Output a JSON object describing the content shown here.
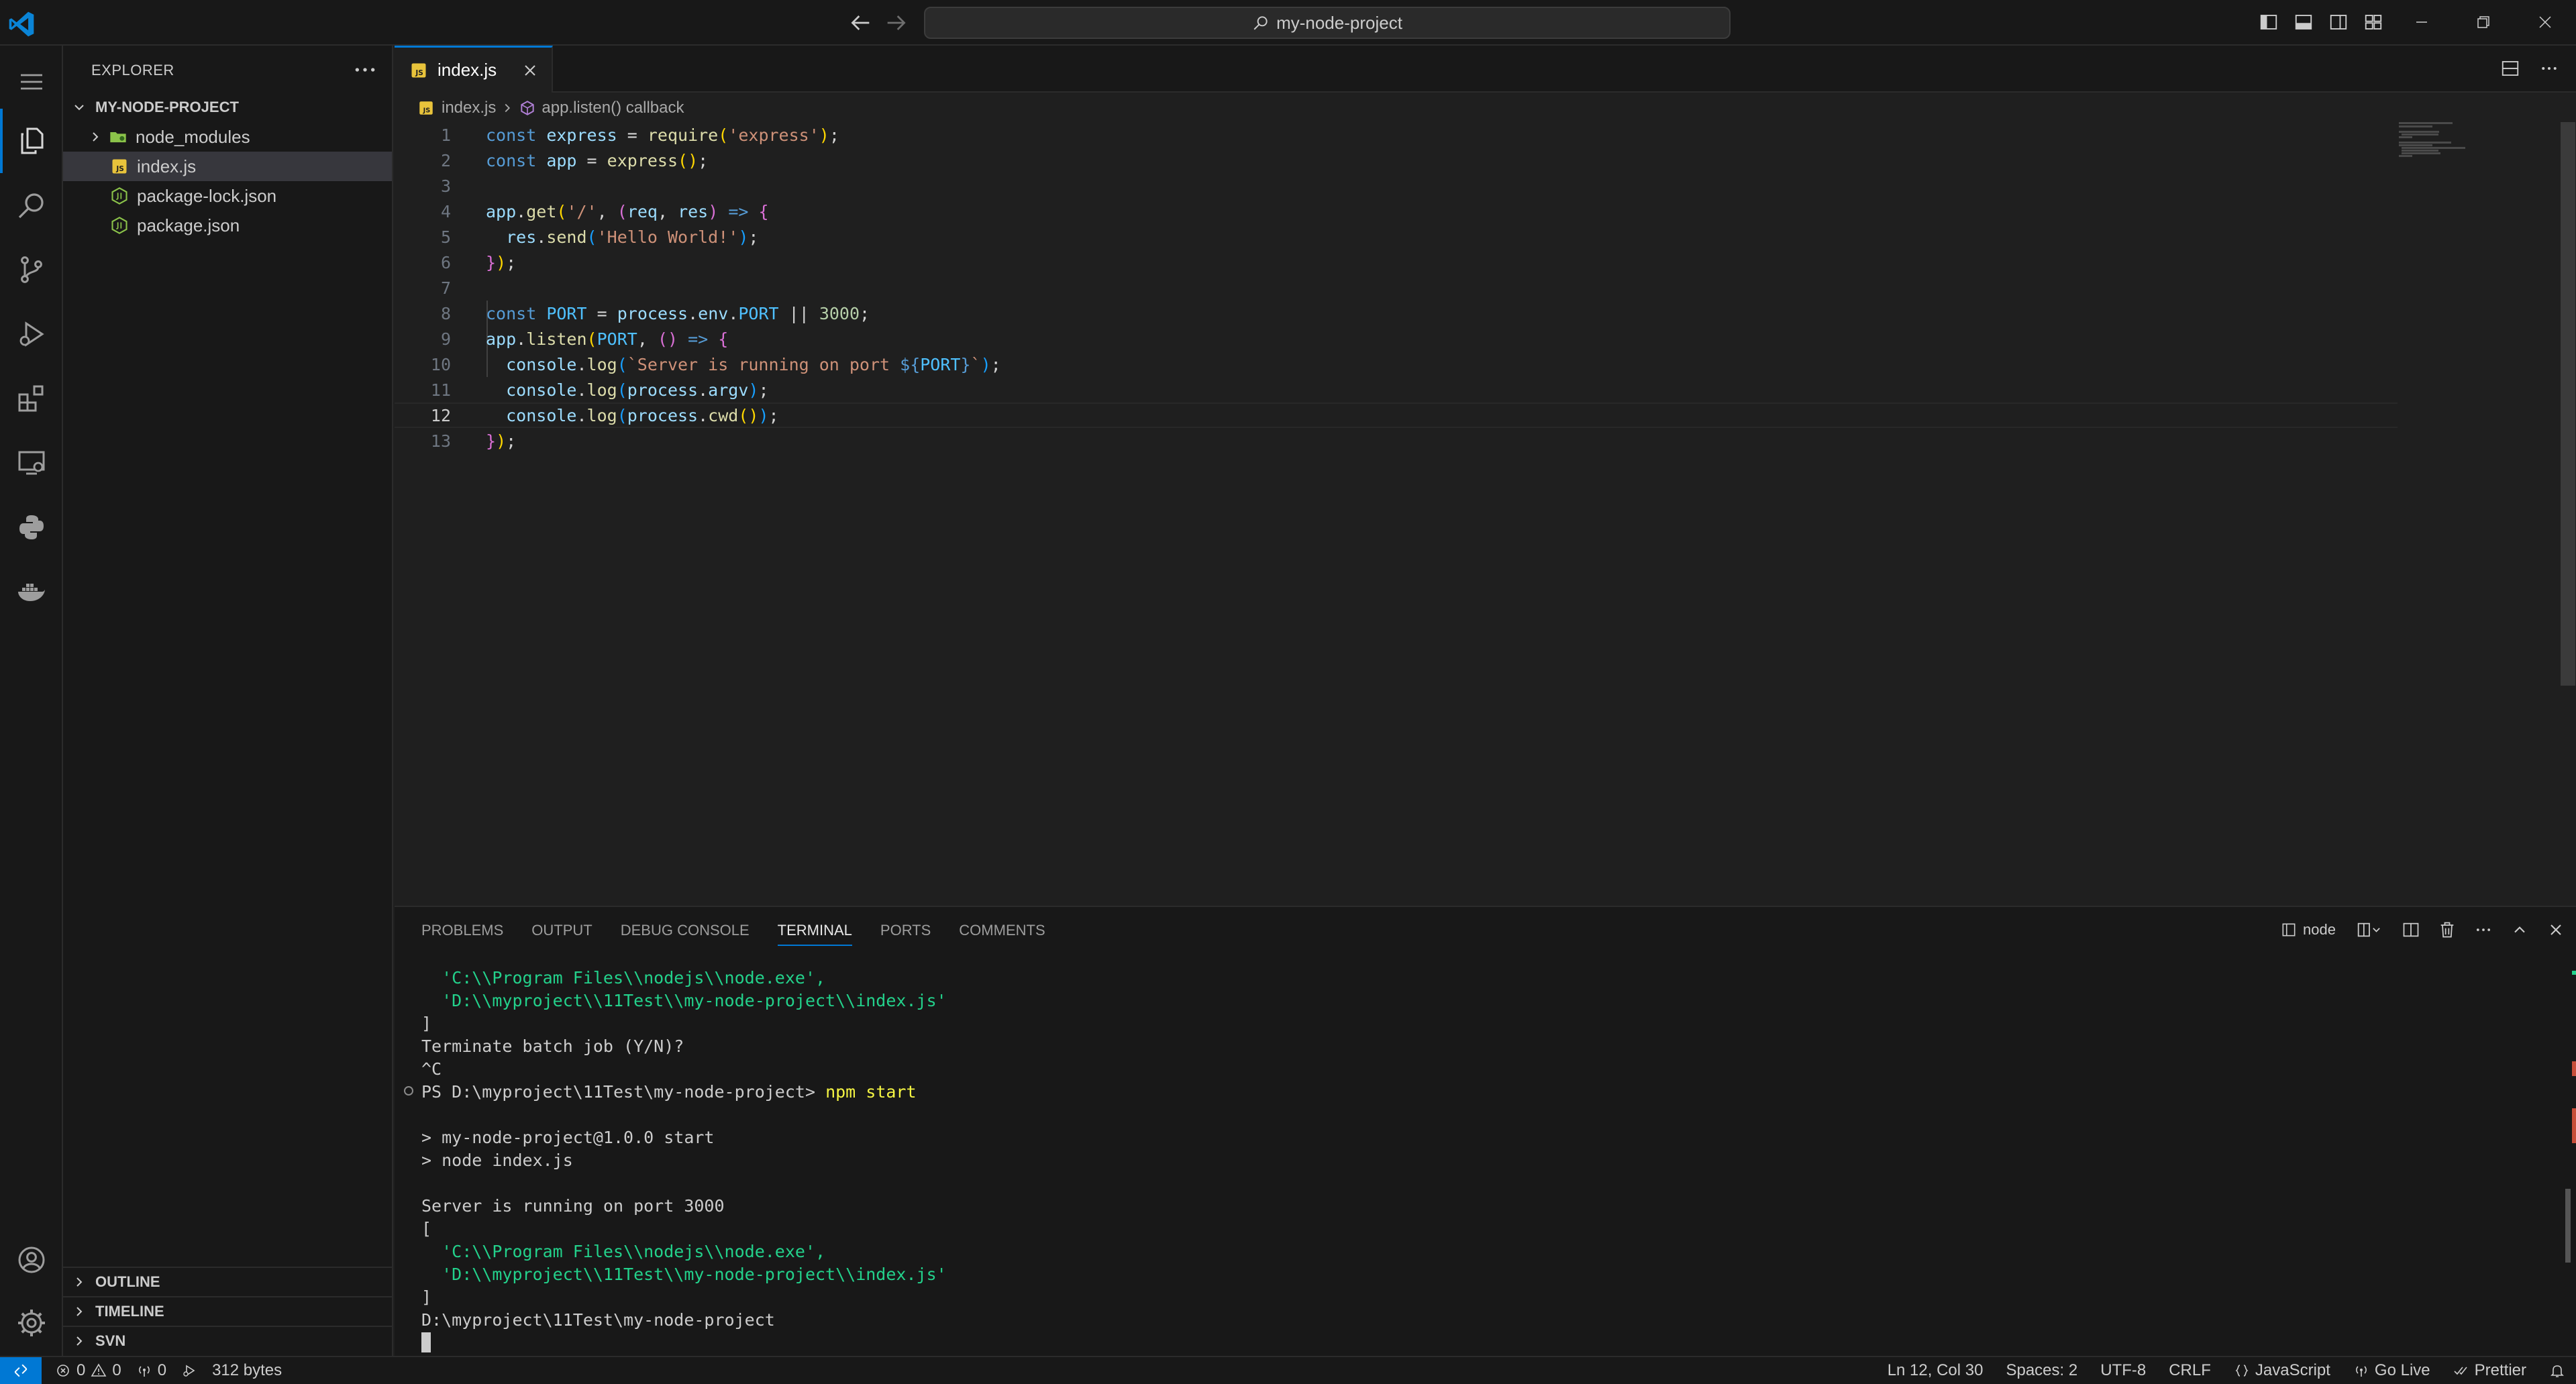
{
  "titlebar": {
    "search_text": "my-node-project"
  },
  "explorer": {
    "title": "EXPLORER",
    "project": "MY-NODE-PROJECT",
    "items": [
      {
        "label": "node_modules",
        "type": "folder"
      },
      {
        "label": "index.js",
        "type": "js",
        "selected": true
      },
      {
        "label": "package-lock.json",
        "type": "json"
      },
      {
        "label": "package.json",
        "type": "json"
      }
    ],
    "sections": [
      "OUTLINE",
      "TIMELINE",
      "SVN"
    ]
  },
  "editor": {
    "tab_label": "index.js",
    "breadcrumb": {
      "file": "index.js",
      "symbol": "app.listen() callback"
    },
    "line_numbers": [
      "1",
      "2",
      "3",
      "4",
      "5",
      "6",
      "7",
      "8",
      "9",
      "10",
      "11",
      "12",
      "13"
    ],
    "current_line": 12,
    "code": [
      "const express = require('express');",
      "const app = express();",
      "",
      "app.get('/', (req, res) => {",
      "  res.send('Hello World!');",
      "});",
      "",
      "const PORT = process.env.PORT || 3000;",
      "app.listen(PORT, () => {",
      "  console.log(`Server is running on port ${PORT}`);",
      "  console.log(process.argv);",
      "  console.log(process.cwd());",
      "});"
    ]
  },
  "panel": {
    "tabs": [
      "PROBLEMS",
      "OUTPUT",
      "DEBUG CONSOLE",
      "TERMINAL",
      "PORTS",
      "COMMENTS"
    ],
    "active_tab": "TERMINAL",
    "terminal_name": "node",
    "terminal_lines": [
      "  'C:\\\\Program Files\\\\nodejs\\\\node.exe',",
      "  'D:\\\\myproject\\\\11Test\\\\my-node-project\\\\index.js'",
      "]",
      "Terminate batch job (Y/N)?",
      "^C",
      "PS D:\\myproject\\11Test\\my-node-project> ",
      "",
      "> my-node-project@1.0.0 start",
      "> node index.js",
      "",
      "Server is running on port 3000",
      "[",
      "  'C:\\\\Program Files\\\\nodejs\\\\node.exe',",
      "  'D:\\\\myproject\\\\11Test\\\\my-node-project\\\\index.js'",
      "]",
      "D:\\myproject\\11Test\\my-node-project"
    ],
    "command": "npm start"
  },
  "statusbar": {
    "errors": "0",
    "warnings": "0",
    "ports": "0",
    "file_size": "312 bytes",
    "position": "Ln 12, Col 30",
    "spaces": "Spaces: 2",
    "encoding": "UTF-8",
    "eol": "CRLF",
    "language": "JavaScript",
    "go_live": "Go Live",
    "prettier": "Prettier"
  },
  "colors": {
    "accent": "#0078d4",
    "background": "#1f1f1f",
    "sidebar": "#181818"
  }
}
